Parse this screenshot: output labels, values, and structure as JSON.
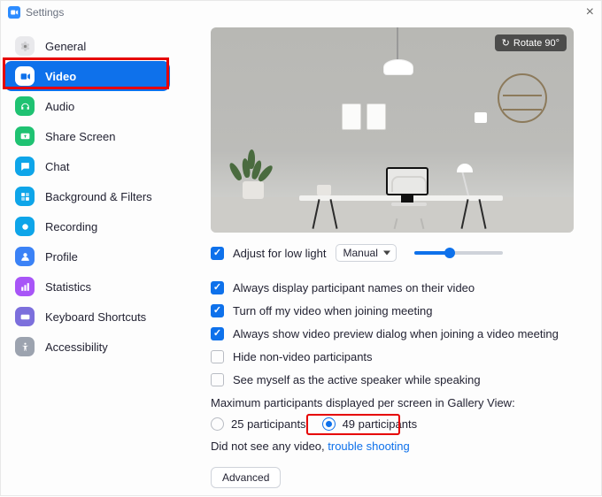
{
  "window": {
    "title": "Settings"
  },
  "sidebar": {
    "items": [
      {
        "label": "General",
        "icon_bg": "#e9e9ec"
      },
      {
        "label": "Video",
        "icon_bg": "#ffffff",
        "active": true
      },
      {
        "label": "Audio",
        "icon_bg": "#22c55e"
      },
      {
        "label": "Share Screen",
        "icon_bg": "#22c55e"
      },
      {
        "label": "Chat",
        "icon_bg": "#0ea5e9"
      },
      {
        "label": "Background & Filters",
        "icon_bg": "#0ea5e9"
      },
      {
        "label": "Recording",
        "icon_bg": "#0ea5e9"
      },
      {
        "label": "Profile",
        "icon_bg": "#3b82f6"
      },
      {
        "label": "Statistics",
        "icon_bg": "#a855f7"
      },
      {
        "label": "Keyboard Shortcuts",
        "icon_bg": "#7c6fdc"
      },
      {
        "label": "Accessibility",
        "icon_bg": "#9ca3af"
      }
    ]
  },
  "preview": {
    "rotate_label": "Rotate 90°"
  },
  "lowlight": {
    "label": "Adjust for low light",
    "checked": true,
    "mode": "Manual",
    "slider_pct": 40
  },
  "options": [
    {
      "label": "Always display participant names on their video",
      "checked": true
    },
    {
      "label": "Turn off my video when joining meeting",
      "checked": true
    },
    {
      "label": "Always show video preview dialog when joining a video meeting",
      "checked": true
    },
    {
      "label": "Hide non-video participants",
      "checked": false
    },
    {
      "label": "See myself as the active speaker while speaking",
      "checked": false
    }
  ],
  "gallery": {
    "heading": "Maximum participants displayed per screen in Gallery View:",
    "choices": [
      {
        "label": "25 participants",
        "checked": false
      },
      {
        "label": "49 participants",
        "checked": true
      }
    ]
  },
  "troubleshoot": {
    "prefix": "Did not see any video, ",
    "link": "trouble shooting"
  },
  "advanced": {
    "label": "Advanced"
  }
}
